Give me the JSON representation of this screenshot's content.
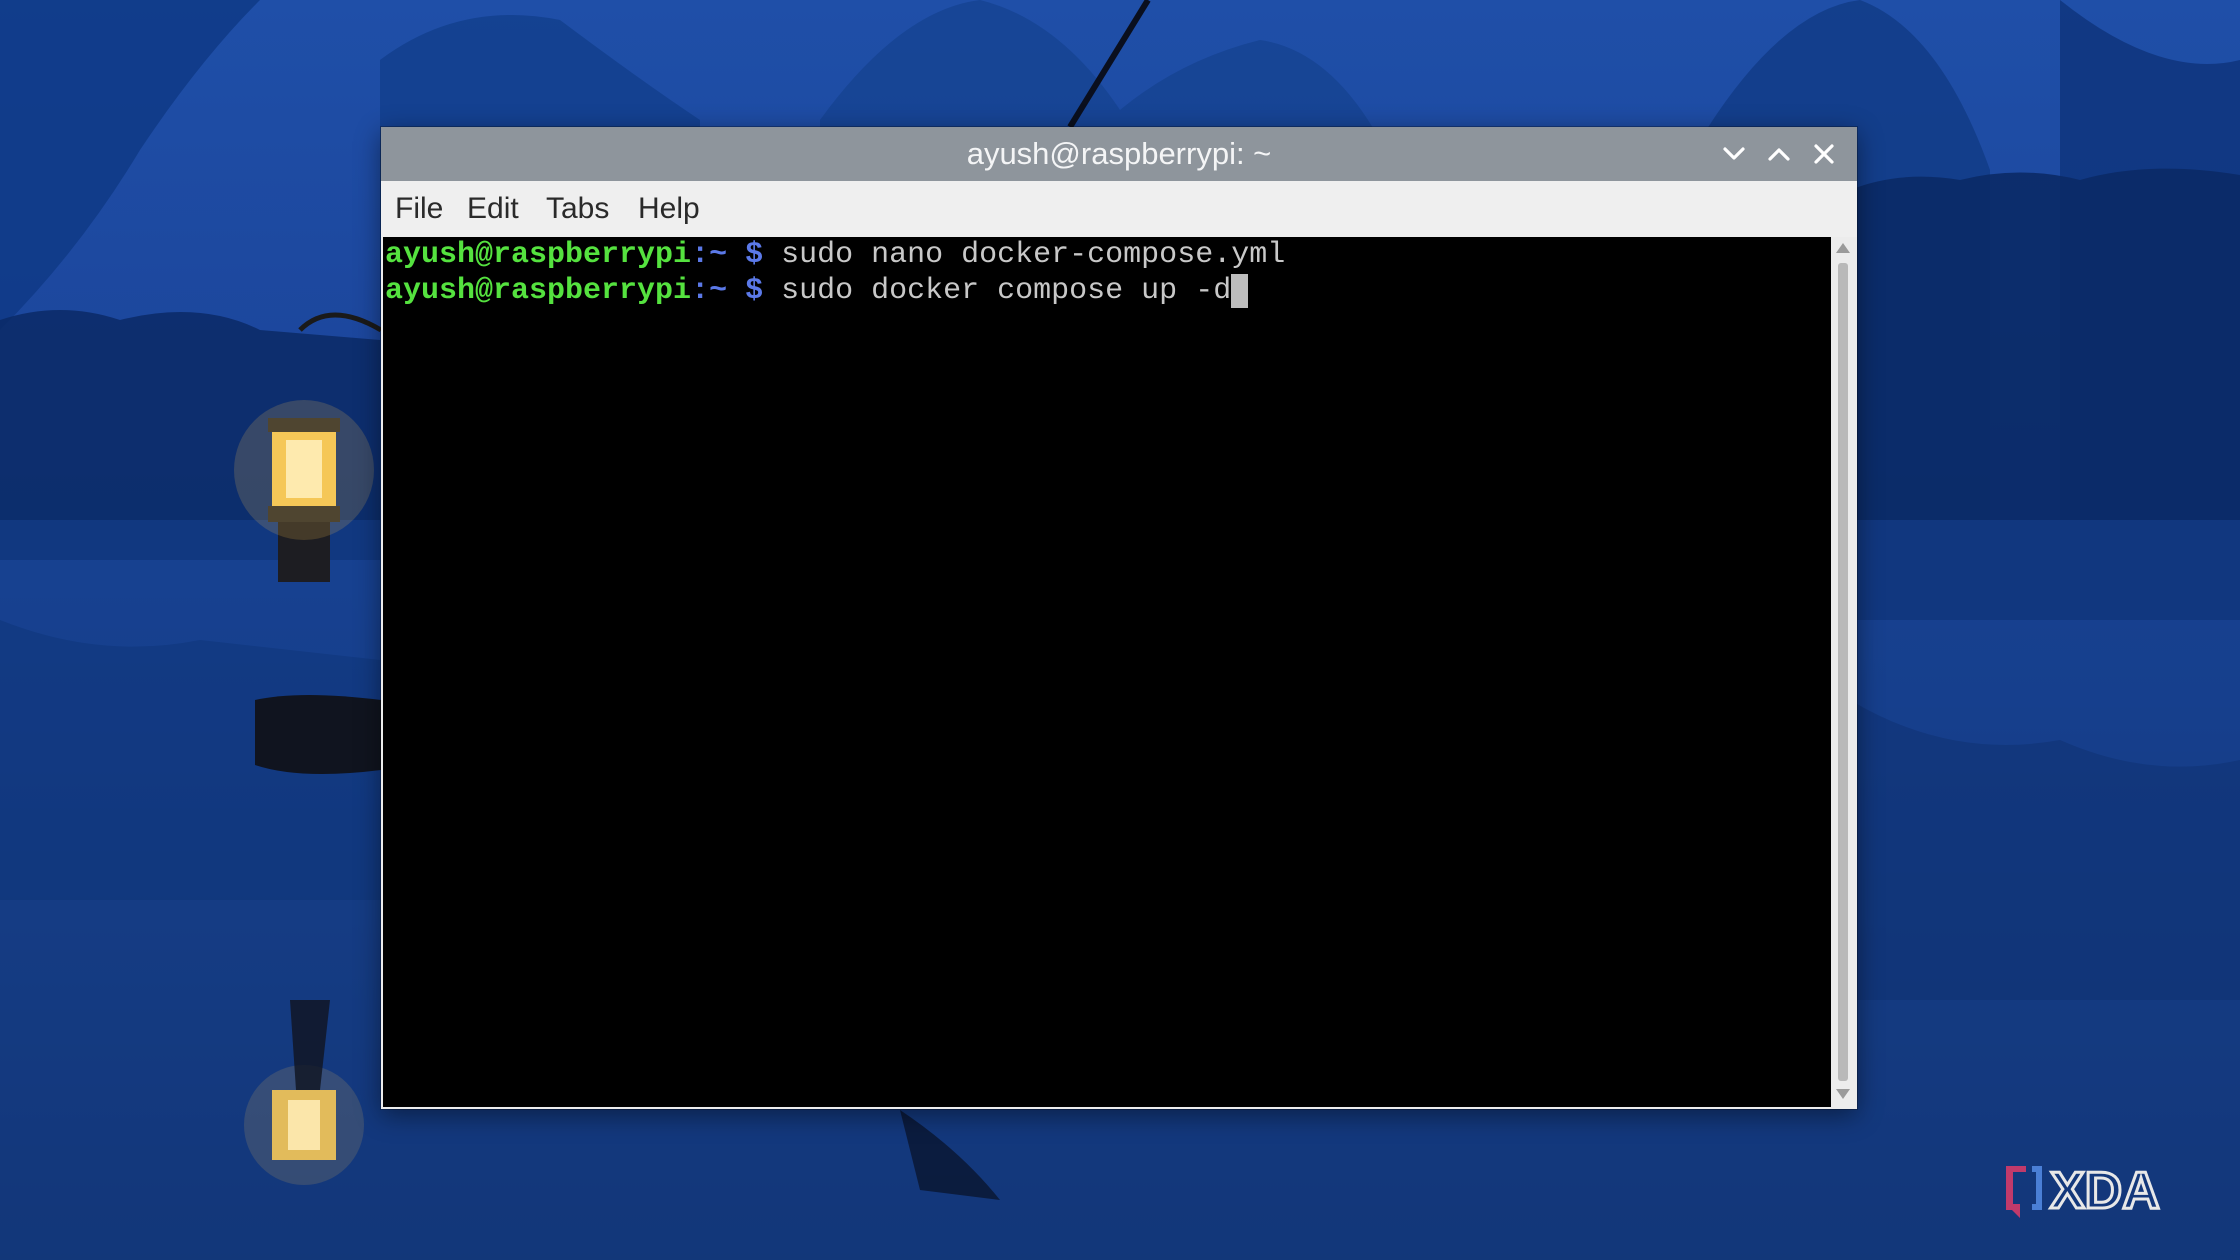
{
  "window": {
    "title": "ayush@raspberrypi: ~",
    "controls": {
      "minimize": "chevron-down-icon",
      "maximize": "chevron-up-icon",
      "close": "close-icon"
    }
  },
  "menu": {
    "file": "File",
    "edit": "Edit",
    "tabs": "Tabs",
    "help": "Help"
  },
  "terminal": {
    "lines": [
      {
        "user_host": "ayush@raspberrypi",
        "path": ":~",
        "symbol": "$",
        "command": "sudo nano docker-compose.yml"
      },
      {
        "user_host": "ayush@raspberrypi",
        "path": ":~",
        "symbol": "$",
        "command": "sudo docker compose up -d"
      }
    ]
  },
  "watermark": {
    "text": "XDA",
    "icon": "xda-logo-icon"
  },
  "colors": {
    "prompt_user": "#55e23f",
    "prompt_symbol": "#5b79e8",
    "command_text": "#c8c8c8",
    "terminal_bg": "#000000",
    "titlebar_bg": "#8e959c"
  }
}
